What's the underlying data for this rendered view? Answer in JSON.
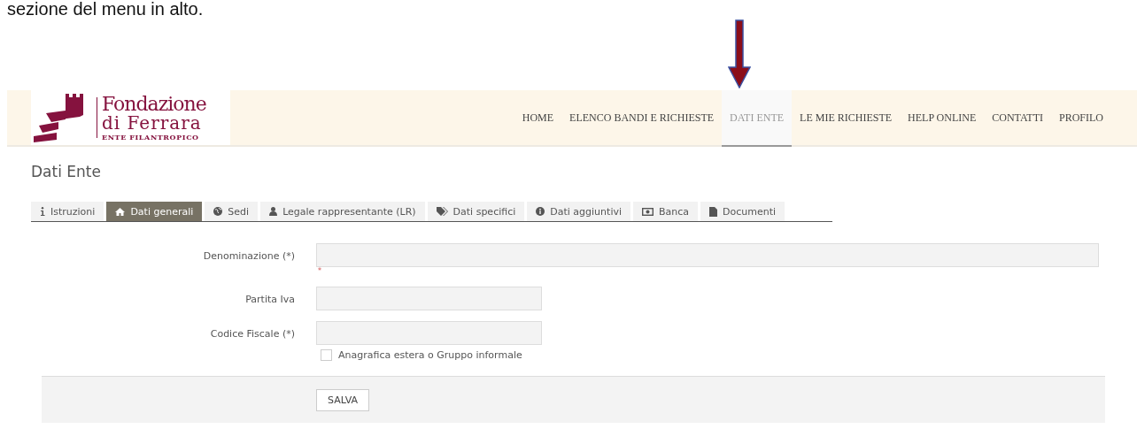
{
  "caption": "sezione del menu in alto.",
  "logo": {
    "name_line_1": "Fondazione",
    "name_line_2": "di Ferrara",
    "tagline": "ENTE FILANTROPICO"
  },
  "nav": [
    {
      "label": "HOME",
      "selected": false
    },
    {
      "label": "ELENCO BANDI E RICHIESTE",
      "selected": false
    },
    {
      "label": "DATI ENTE",
      "selected": true
    },
    {
      "label": "LE MIE RICHIESTE",
      "selected": false
    },
    {
      "label": "HELP ONLINE",
      "selected": false
    },
    {
      "label": "CONTATTI",
      "selected": false
    },
    {
      "label": "PROFILO",
      "selected": false
    }
  ],
  "page_title": "Dati Ente",
  "tabs": [
    {
      "label": "Istruzioni",
      "kind": "info",
      "selected": false
    },
    {
      "label": "Dati generali",
      "kind": "home",
      "selected": true
    },
    {
      "label": "Sedi",
      "kind": "globe",
      "selected": false
    },
    {
      "label": "Legale rappresentante (LR)",
      "kind": "user",
      "selected": false
    },
    {
      "label": "Dati specifici",
      "kind": "tags",
      "selected": false
    },
    {
      "label": "Dati aggiuntivi",
      "kind": "notice",
      "selected": false
    },
    {
      "label": "Banca",
      "kind": "bank",
      "selected": false
    },
    {
      "label": "Documenti",
      "kind": "document",
      "selected": false
    }
  ],
  "fields": [
    {
      "label": "Denominazione (*)",
      "kind": "wide",
      "required_mark": "*"
    },
    {
      "label": "Partita Iva",
      "kind": "short"
    },
    {
      "label": "Codice Fiscale (*)",
      "kind": "short",
      "checkbox": {
        "label": "Anagrafica estera o Gruppo informale",
        "checked": false
      }
    }
  ],
  "save_button": "SALVA"
}
